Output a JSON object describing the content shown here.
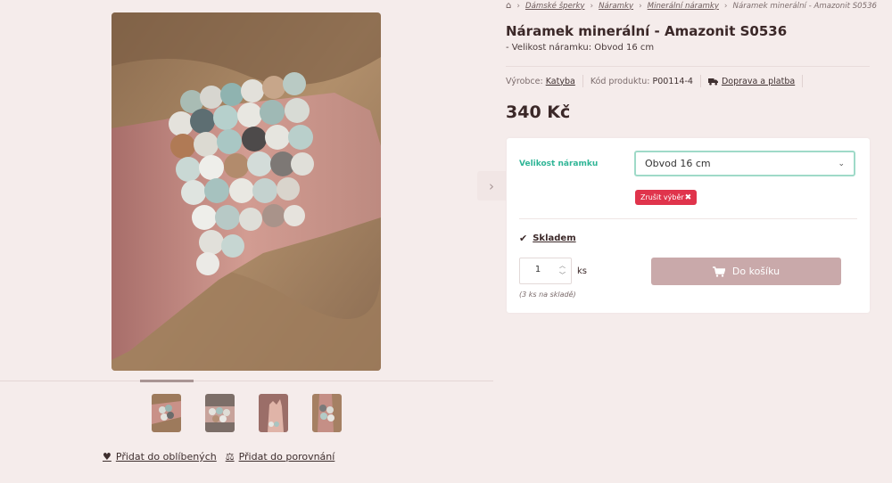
{
  "breadcrumb": {
    "items": [
      "Dámské šperky",
      "Náramky",
      "Minerální náramky"
    ],
    "current": "Náramek minerální - Amazonit S0536"
  },
  "product": {
    "title": "Náramek minerální - Amazonit S0536",
    "subtitle": "- Velikost náramku: Obvod 16 cm",
    "price": "340 Kč"
  },
  "meta": {
    "brand_label": "Výrobce:",
    "brand": "Katyba",
    "code_label": "Kód produktu:",
    "code": "P00114-4",
    "shipping_link": "Doprava a platba"
  },
  "variant": {
    "label": "Velikost náramku",
    "selected": "Obvod 16 cm",
    "reset_label": "Zrušit výběr"
  },
  "availability": {
    "status": "Skladem",
    "stock_note": "(3 ks na skladě)"
  },
  "cart": {
    "quantity": "1",
    "unit": "ks",
    "button_label": "Do košíku"
  },
  "gallery": {
    "thumbnail_count": 4,
    "active_thumbnail": 1
  },
  "links": {
    "favorites": "Přidat do oblíbených",
    "compare": "Přidat do porovnání"
  },
  "icons": [
    "home-icon",
    "chevron-right-icon",
    "truck-icon",
    "check-icon",
    "chevron-down-icon",
    "close-icon",
    "cart-icon",
    "heart-icon",
    "scale-icon",
    "chevron-up-icon"
  ],
  "colors": {
    "accent_green": "#2fb596",
    "reset_red": "#e0344c",
    "cart_button": "#c9a9aa",
    "page_background": "#f5eceb"
  }
}
